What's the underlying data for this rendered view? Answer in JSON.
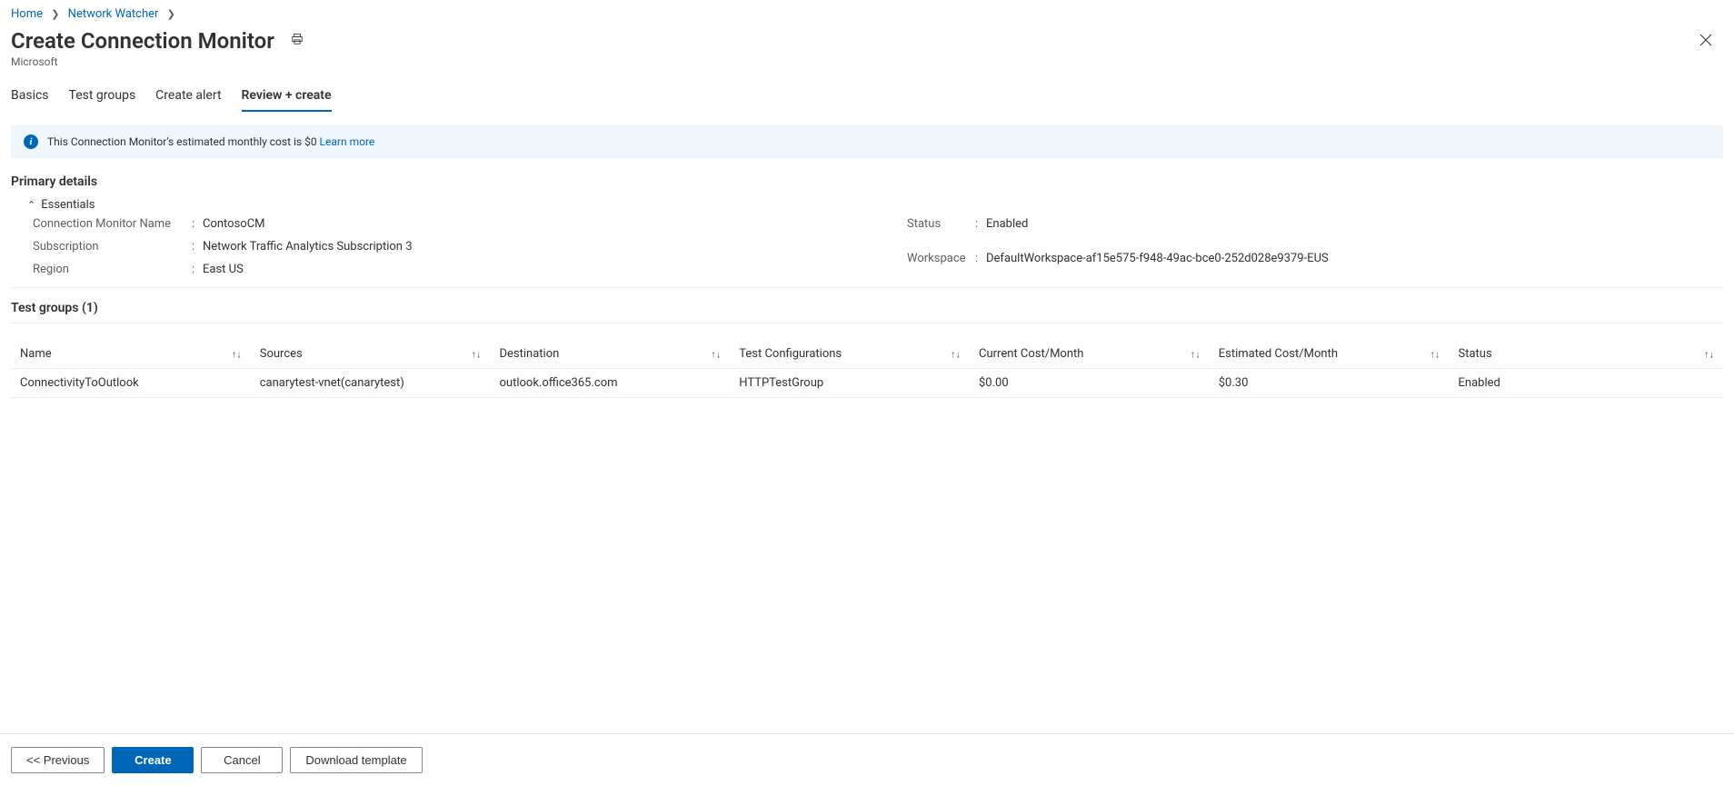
{
  "breadcrumb": {
    "items": [
      "Home",
      "Network Watcher"
    ]
  },
  "page": {
    "title": "Create Connection Monitor",
    "provider": "Microsoft"
  },
  "tabs": {
    "items": [
      {
        "label": "Basics",
        "active": false
      },
      {
        "label": "Test groups",
        "active": false
      },
      {
        "label": "Create alert",
        "active": false
      },
      {
        "label": "Review + create",
        "active": true
      }
    ]
  },
  "banner": {
    "text": "This Connection Monitor's estimated monthly cost is $0 ",
    "link_label": "Learn more"
  },
  "primary_details": {
    "section_title": "Primary details",
    "essentials_label": "Essentials",
    "left": {
      "connection_monitor_name": {
        "key": "Connection Monitor Name",
        "value": "ContosoCM"
      },
      "subscription": {
        "key": "Subscription",
        "value": "Network Traffic Analytics Subscription 3"
      },
      "region": {
        "key": "Region",
        "value": "East US"
      }
    },
    "right": {
      "status": {
        "key": "Status",
        "value": "Enabled"
      },
      "workspace": {
        "key": "Workspace",
        "value": "DefaultWorkspace-af15e575-f948-49ac-bce0-252d028e9379-EUS"
      }
    }
  },
  "test_groups": {
    "title": "Test groups (1)",
    "columns": {
      "name": "Name",
      "sources": "Sources",
      "destination": "Destination",
      "test_configs": "Test Configurations",
      "current_cost": "Current Cost/Month",
      "est_cost": "Estimated Cost/Month",
      "status": "Status"
    },
    "rows": [
      {
        "name": "ConnectivityToOutlook",
        "sources": "canarytest-vnet(canarytest)",
        "destination": "outlook.office365.com",
        "test_configs": "HTTPTestGroup",
        "current_cost": "$0.00",
        "est_cost": "$0.30",
        "status": "Enabled"
      }
    ]
  },
  "footer": {
    "previous": "<<  Previous",
    "create": "Create",
    "cancel": "Cancel",
    "download": "Download template"
  }
}
